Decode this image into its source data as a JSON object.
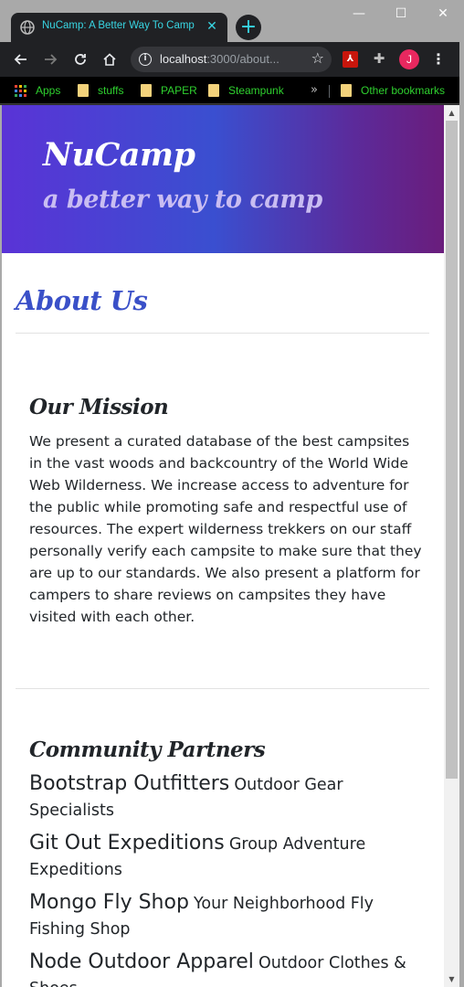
{
  "browser": {
    "tab_title": "NuCamp: A Better Way To Camp",
    "tab_close": "✕",
    "new_tab": "+",
    "url_host": "localhost",
    "url_rest": ":3000/about...",
    "controls": {
      "minimize": "—",
      "maximize": "☐",
      "close": "✕"
    },
    "avatar_letter": "J",
    "bookmarks": [
      "Apps",
      "stuffs",
      "PAPER",
      "Steampunk"
    ],
    "overflow": "»",
    "other_bookmarks": "Other bookmarks",
    "accent": "#38d6e3",
    "bookmark_color": "#2fd12f"
  },
  "header": {
    "brand": "NuCamp",
    "tagline": "a better way to camp"
  },
  "page": {
    "title": "About Us"
  },
  "mission": {
    "heading": "Our Mission",
    "text": "We present a curated database of the best campsites in the vast woods and backcountry of the World Wide Web Wilderness. We increase access to adventure for the public while promoting safe and respectful use of resources. The expert wilderness trekkers on our staff personally verify each campsite to make sure that they are up to our standards. We also present a platform for campers to share reviews on campsites they have visited with each other."
  },
  "partners": {
    "heading": "Community Partners",
    "items": [
      {
        "name": "Bootstrap Outfitters",
        "desc": "Outdoor Gear Specialists"
      },
      {
        "name": "Git Out Expeditions",
        "desc": "Group Adventure Expeditions"
      },
      {
        "name": "Mongo Fly Shop",
        "desc": "Your Neighborhood Fly Fishing Shop"
      },
      {
        "name": "Node Outdoor Apparel",
        "desc": "Outdoor Clothes & Shoes"
      }
    ]
  }
}
